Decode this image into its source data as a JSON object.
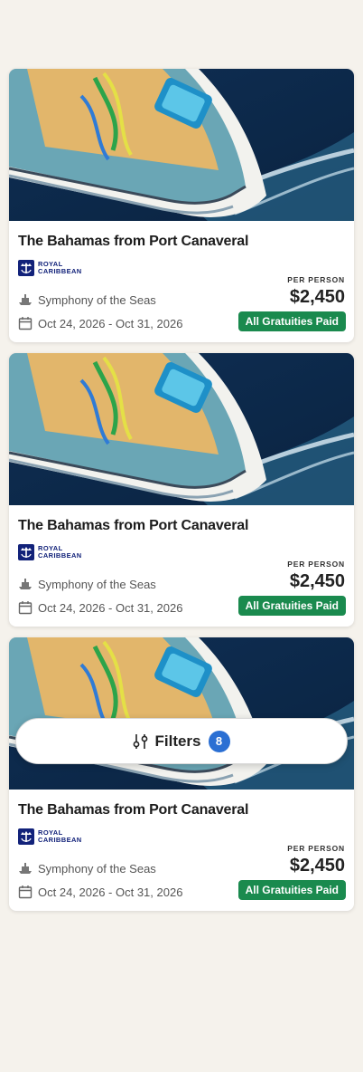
{
  "results": [
    {
      "title": "The Bahamas from Port Canaveral",
      "brand": {
        "line1": "ROYAL",
        "line2": "CARIBBEAN",
        "icon": "crown-anchor-logo"
      },
      "ship": "Symphony of the Seas",
      "dates": "Oct 24, 2026 - Oct 31, 2026",
      "price_caption": "PER PERSON",
      "price": "$2,450",
      "badge": "All Gratuities Paid"
    },
    {
      "title": "The Bahamas from Port Canaveral",
      "brand": {
        "line1": "ROYAL",
        "line2": "CARIBBEAN",
        "icon": "crown-anchor-logo"
      },
      "ship": "Symphony of the Seas",
      "dates": "Oct 24, 2026 - Oct 31, 2026",
      "price_caption": "PER PERSON",
      "price": "$2,450",
      "badge": "All Gratuities Paid"
    },
    {
      "title": "The Bahamas from Port Canaveral",
      "brand": {
        "line1": "ROYAL",
        "line2": "CARIBBEAN",
        "icon": "crown-anchor-logo"
      },
      "ship": "Symphony of the Seas",
      "dates": "Oct 24, 2026 - Oct 31, 2026",
      "price_caption": "PER PERSON",
      "price": "$2,450",
      "badge": "All Gratuities Paid"
    }
  ],
  "filters": {
    "label": "Filters",
    "count": "8",
    "icon": "sliders-icon"
  },
  "colors": {
    "background": "#f5f2ec",
    "badge": "#1a8a4e",
    "brand": "#12227a",
    "filter_count": "#2a6fd3"
  }
}
